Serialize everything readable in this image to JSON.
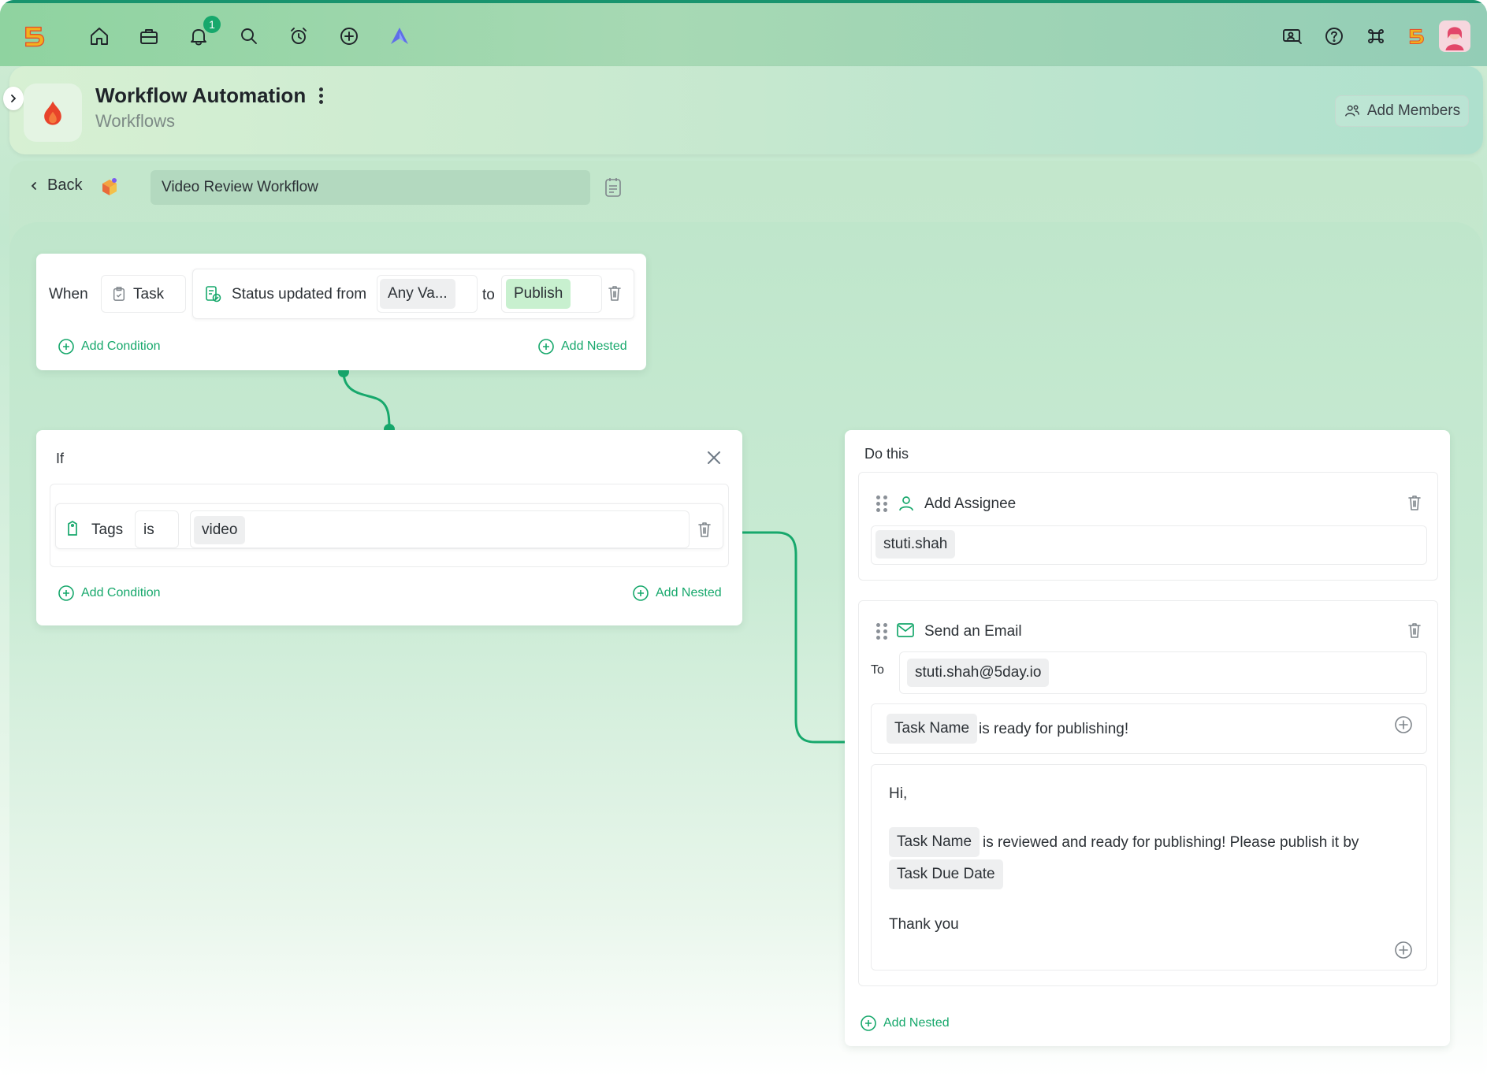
{
  "topbar": {
    "notification_count": "1",
    "icons": [
      "logo-5day",
      "home-icon",
      "briefcase-icon",
      "bell-icon",
      "search-icon",
      "alarm-icon",
      "plus-circle-icon",
      "a-logo-icon",
      "screen-share-icon",
      "help-icon",
      "command-icon",
      "logo-5day-small",
      "user-avatar"
    ]
  },
  "header": {
    "title": "Workflow Automation",
    "subtitle": "Workflows",
    "add_members_label": "Add Members"
  },
  "toolbar": {
    "back_label": "Back",
    "workflow_name": "Video Review Workflow"
  },
  "when_card": {
    "when_label": "When",
    "entity": "Task",
    "trigger": "Status updated from",
    "from_value": "Any Va...",
    "to_label": "to",
    "to_value": "Publish",
    "add_condition": "Add Condition",
    "add_nested": "Add Nested"
  },
  "if_card": {
    "label": "If",
    "field": "Tags",
    "operator": "is",
    "value": "video",
    "add_condition": "Add Condition",
    "add_nested": "Add Nested"
  },
  "do_card": {
    "label": "Do this",
    "assignee_action": {
      "title": "Add Assignee",
      "value": "stuti.shah"
    },
    "email_action": {
      "title": "Send an Email",
      "to_label": "To",
      "to_value": "stuti.shah@5day.io",
      "subject_token": "Task Name",
      "subject_text": "is ready for publishing!",
      "body_greeting": "Hi,",
      "body_token_1": "Task Name",
      "body_text": "is reviewed and ready for publishing! Please publish it by",
      "body_token_2": "Task Due Date",
      "body_signoff": "Thank you"
    },
    "add_nested": "Add Nested"
  },
  "colors": {
    "accent_green": "#17a86c",
    "publish_chip": "#c8f0cf",
    "chip_gray": "#eeeff0"
  }
}
